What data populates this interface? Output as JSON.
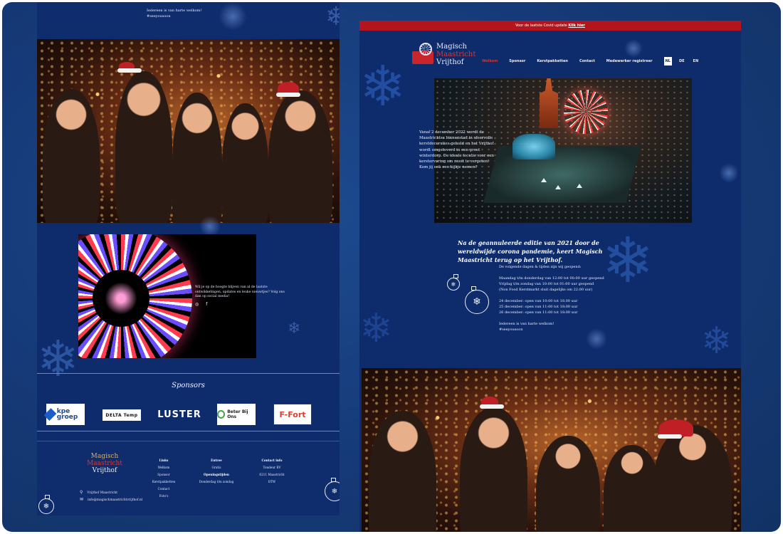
{
  "left": {
    "top_text": [
      "Iedereen is van harte welkom!",
      "#seeyousoon"
    ],
    "social_text": "Wil je op de hoogte blijven van al de laatste ontwikkelingen, updates en leuke nieuwtjes? Volg ons dan op social media!",
    "social_icons": [
      "instagram-icon",
      "facebook-icon"
    ],
    "sponsors_title": "Sponsors",
    "sponsors": [
      "kpe groep",
      "DELTA Temp",
      "LUSTER",
      "Beter Bij Ons",
      "F-Fort"
    ],
    "footer": {
      "logo": [
        "Magisch",
        "Maastricht",
        "Vrijthof"
      ],
      "address": "Vrijthof Maastricht",
      "email": "info@magischmaastrichtvrijthof.nl",
      "links_title": "Links",
      "links": [
        "Welkom",
        "Sponsor",
        "Kerstpakketten",
        "Contact",
        "Foto's"
      ],
      "entree_title": "Entree",
      "entree_text": "Gratis",
      "openingstijden_title": "Openingstijden",
      "openingstijden_text": "Donderdag t/m zondag",
      "contact_title": "Contact info",
      "contact_lines": [
        "Tondeur BV",
        "6211 Maastricht",
        "BTW"
      ]
    }
  },
  "right": {
    "covid_text": "Voor de laatste Covid update",
    "covid_link": "Klik hier",
    "logo": [
      "Magisch",
      "Maastricht",
      "Vrijthof"
    ],
    "nav": [
      "Welkom",
      "Sponsor",
      "Kerstpakketten",
      "Contact",
      "Medewerker registreer"
    ],
    "languages": [
      "NL",
      "DE",
      "EN"
    ],
    "selected_language": "NL",
    "intro": "Vanaf 2 december 2022 wordt de Maastrichtse binnenstad in sfeervolle kerstdecoraties gehuld en het Vrijthof wordt omgetoverd in een groot winterdorp. De ideale locatie voor een kerstervaring om nooit te vergeten! Kom jij ook een kijkje nemen?",
    "headline": "Na de geannuleerde editie van 2021 door de wereldwijde corona pandemie, keert Magisch Maastricht terug op het Vrijthof.",
    "schedule": [
      "De volgende dagen & tijden zijn wij geopend:",
      "Maandag t/m donderdag van 12:00 tot 00:00 uur geopend",
      "Vrijdag t/m zondag van 10:00 tot 01:00 uur geopend",
      "(Non Food Kerstmarkt sluit dagelijks om 22:00 uur)",
      "24 december: open van 10:00 tot 18.00 uur",
      "25 december: open van 11:00 tot 18:00 uur",
      "26 december: open van 11:00 tot 18:00 uur",
      "Iedereen is van harte welkom!",
      "#seeyousoon"
    ]
  }
}
